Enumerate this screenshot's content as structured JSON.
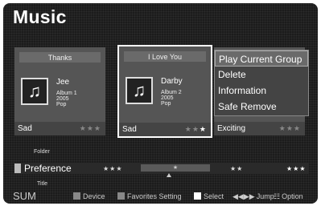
{
  "title": "Music",
  "cards": [
    {
      "header": "Thanks",
      "song": "Jee",
      "album": "Album 1",
      "year": "2005",
      "genre": "Pop",
      "mood": "Sad",
      "rating_stars": 3,
      "lit_stars": 0,
      "icon": "music-note-icon"
    },
    {
      "header": "I Love You",
      "song": "Darby",
      "album": "Album 2",
      "year": "2005",
      "genre": "Pop",
      "mood": "Sad",
      "rating_stars": 3,
      "lit_stars": 1,
      "icon": "music-note-icon"
    },
    {
      "header": "",
      "song": "",
      "album": "",
      "year": "",
      "genre": "",
      "mood": "Exciting",
      "rating_stars": 3,
      "lit_stars": 0,
      "icon": ""
    }
  ],
  "popup": {
    "items": [
      "Play Current Group",
      "Delete",
      "Information",
      "Safe Remove"
    ],
    "selected_index": 0
  },
  "preference": {
    "folder_label": "Folder",
    "label": "Preference",
    "title_label": "Title",
    "slots": [
      "★★★",
      "★★",
      "★★★"
    ],
    "active_slot": "★"
  },
  "bottom_bar": {
    "logo": "SUM",
    "device": "Device",
    "favorites": "Favorites Setting",
    "select": "Select",
    "jump": "Jump",
    "option": "Option"
  },
  "colors": {
    "background": "#1c1c1c",
    "card": "#555555",
    "highlight": "#ffffff"
  }
}
